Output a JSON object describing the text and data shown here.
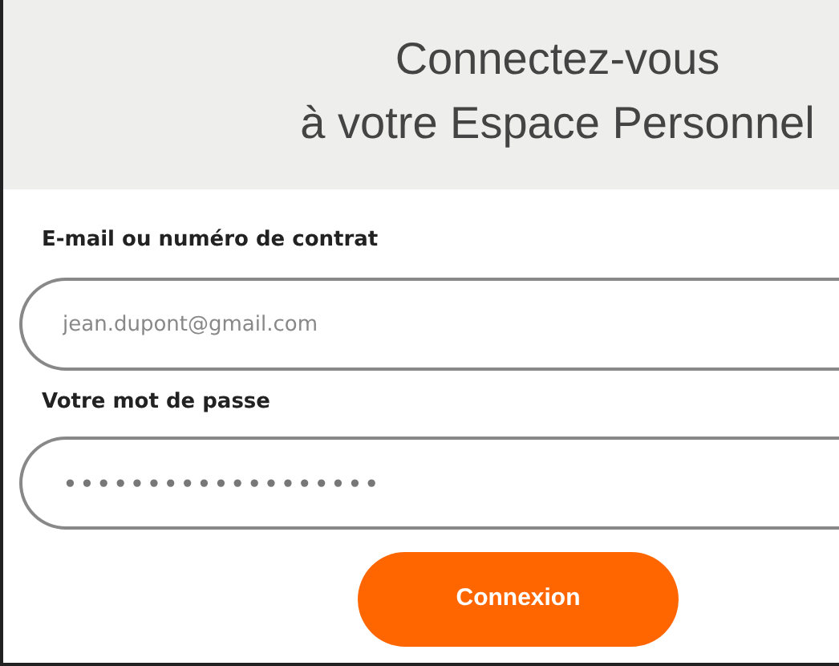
{
  "header": {
    "title_lines": [
      "Connectez-vous",
      "à votre Espace Personnel"
    ]
  },
  "fields": [
    {
      "label": "E-mail ou numéro de contrat",
      "kind": "text",
      "placeholder": "jean.dupont@gmail.com"
    },
    {
      "label": "Votre mot de passe",
      "kind": "password",
      "value": "•••••••••••••••••••"
    }
  ],
  "submit_button": {
    "label": "Connexion"
  }
}
